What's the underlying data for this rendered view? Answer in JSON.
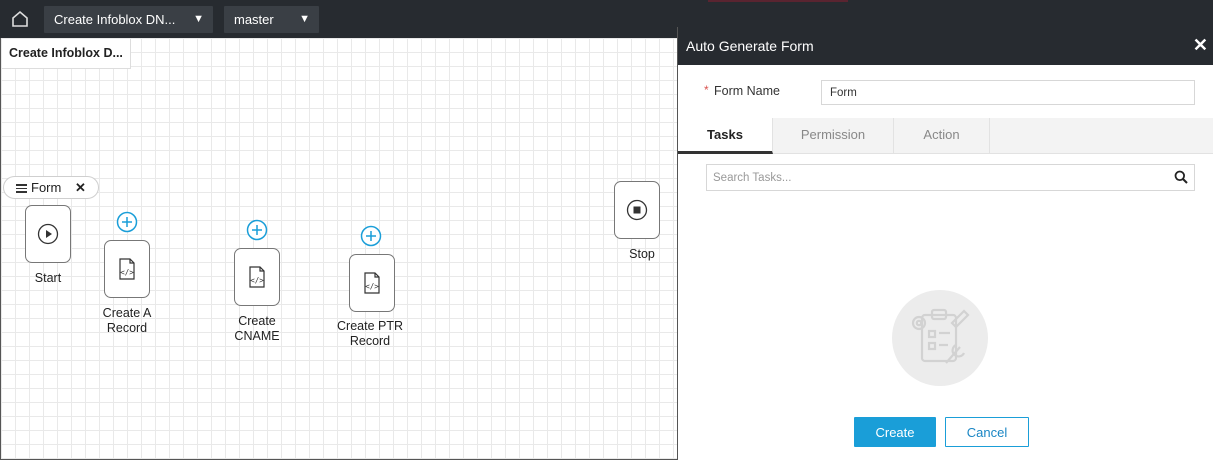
{
  "topbar": {
    "workflow_select": "Create Infoblox DN...",
    "branch_select": "master",
    "home_icon": "home-icon",
    "chevron_icon": "chevron-down-icon"
  },
  "canvas": {
    "title": "Create Infoblox D...",
    "form_chip": {
      "label": "Form",
      "close": "✕",
      "icon": "list-icon"
    },
    "nodes": [
      {
        "id": "start",
        "label": "Start",
        "icon": "play-icon"
      },
      {
        "id": "create-a-record",
        "label_line1": "Create A",
        "label_line2": "Record",
        "icon": "code-file-icon"
      },
      {
        "id": "create-cname",
        "label_line1": "Create",
        "label_line2": "CNAME",
        "icon": "code-file-icon"
      },
      {
        "id": "create-ptr-record",
        "label_line1": "Create PTR",
        "label_line2": "Record",
        "icon": "code-file-icon"
      },
      {
        "id": "stop",
        "label": "Stop",
        "icon": "stop-icon"
      }
    ],
    "add_icon": "plus-circle-icon"
  },
  "panel": {
    "title": "Auto Generate Form",
    "close": "✕",
    "form_name": {
      "required_mark": "*",
      "label": "Form Name",
      "value": "Form"
    },
    "tabs": [
      {
        "label": "Tasks",
        "active": true
      },
      {
        "label": "Permission",
        "active": false
      },
      {
        "label": "Action",
        "active": false
      }
    ],
    "search": {
      "placeholder": "Search Tasks...",
      "icon": "search-icon"
    },
    "empty_state_icon": "clipboard-settings-icon",
    "buttons": {
      "create": "Create",
      "cancel": "Cancel"
    }
  },
  "colors": {
    "topbar_bg": "#272b30",
    "accent_blue": "#1a9ed8",
    "required_red": "#d9534f",
    "grid_line": "#e9e9e9"
  }
}
